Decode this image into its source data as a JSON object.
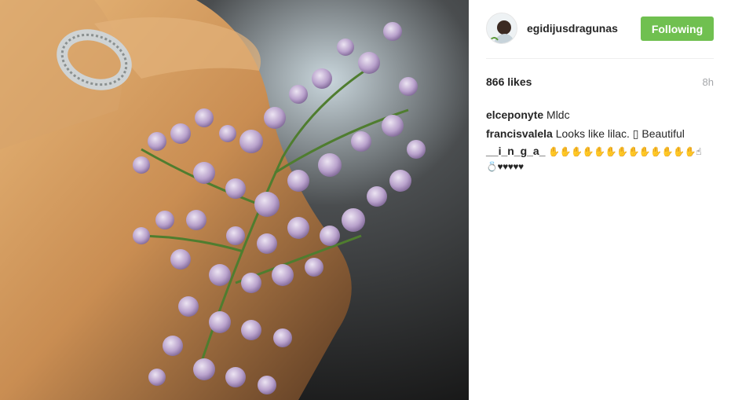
{
  "post": {
    "username": "egidijusdragunas",
    "follow_label": "Following",
    "likes": "866 likes",
    "timestamp": "8h"
  },
  "comments": [
    {
      "author": "elceponyte",
      "text": "Mldc"
    },
    {
      "author": "francisvalela",
      "text": "Looks like lilac. ▯ Beautiful"
    },
    {
      "author": "__i_n_g_a_",
      "text": "✋✋✋✋✋✋✋✋✋✋✋✋✋☝ 💍♥♥♥♥♥"
    }
  ],
  "colors": {
    "follow_button": "#70c050",
    "timestamp": "#a5a7aa"
  },
  "icons": {
    "avatar": "user-avatar"
  }
}
